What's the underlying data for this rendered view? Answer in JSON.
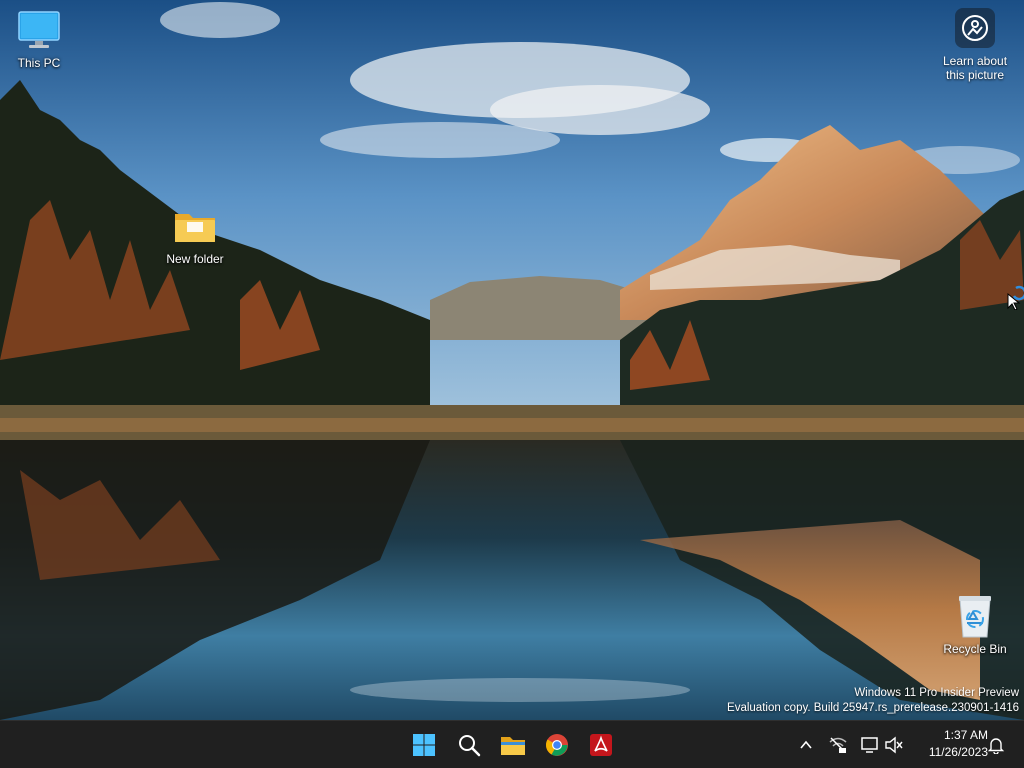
{
  "desktop": {
    "icons": {
      "this_pc": "This PC",
      "new_folder": "New folder",
      "recycle_bin": "Recycle Bin"
    },
    "spotlight": {
      "line1": "Learn about",
      "line2": "this picture"
    },
    "watermark": {
      "line1": "Windows 11 Pro Insider Preview",
      "line2": "Evaluation copy. Build 25947.rs_prerelease.230901-1416"
    }
  },
  "taskbar": {
    "apps": [
      "start-icon",
      "search-icon",
      "file-explorer-icon",
      "chrome-icon",
      "acrobat-icon"
    ],
    "tray": {
      "time": "1:37 AM",
      "date": "11/26/2023"
    }
  },
  "colors": {
    "taskbar_bg": "#202020",
    "start_blue": "#4cc2ff",
    "folder_yellow": "#f4c542",
    "acrobat_red": "#c4161c"
  }
}
